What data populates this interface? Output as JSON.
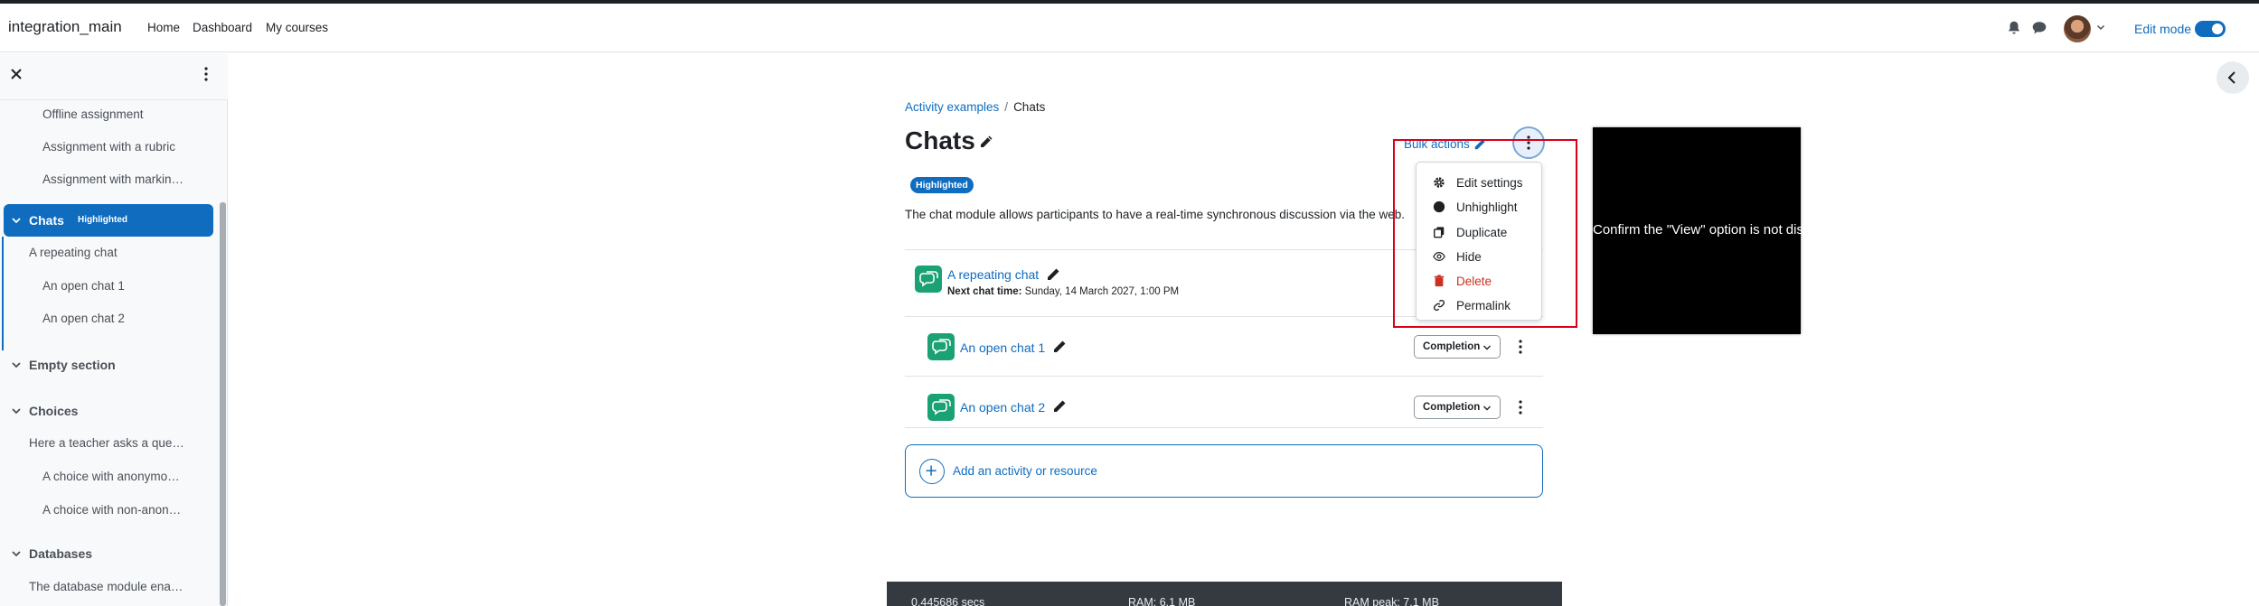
{
  "navbar": {
    "site_name": "integration_main",
    "links": [
      "Home",
      "Dashboard",
      "My courses"
    ],
    "edit_mode_label": "Edit mode",
    "edit_mode_on": true
  },
  "drawer": {
    "items": [
      {
        "label": "Offline assignment",
        "kind": "activity"
      },
      {
        "label": "Assignment with a rubric",
        "kind": "activity"
      },
      {
        "label": "Assignment with markin…",
        "kind": "activity"
      },
      {
        "label": "Chats",
        "kind": "section",
        "badge": "Highlighted",
        "active": true
      },
      {
        "label": "A repeating chat",
        "kind": "activity"
      },
      {
        "label": "An open chat 1",
        "kind": "activity"
      },
      {
        "label": "An open chat 2",
        "kind": "activity"
      },
      {
        "label": "Empty section",
        "kind": "section"
      },
      {
        "label": "Choices",
        "kind": "section"
      },
      {
        "label": "Here a teacher asks a que…",
        "kind": "activity"
      },
      {
        "label": "A choice with anonymo…",
        "kind": "activity"
      },
      {
        "label": "A choice with non-anon…",
        "kind": "activity"
      },
      {
        "label": "Databases",
        "kind": "section"
      },
      {
        "label": "The database module ena…",
        "kind": "activity"
      }
    ]
  },
  "main": {
    "breadcrumb": [
      "Activity examples",
      "/",
      "Chats"
    ],
    "title": "Chats",
    "bulk_actions": "Bulk actions",
    "highlight_badge": "Highlighted",
    "summary": "The chat module allows participants to have a real-time synchronous discussion via the web.",
    "activities": [
      {
        "name": "A repeating chat",
        "next_label": "Next chat time:",
        "next_value": "Sunday, 14 March 2027, 1:00 PM"
      },
      {
        "name": "An open chat 1",
        "completion": "Completion"
      },
      {
        "name": "An open chat 2",
        "completion": "Completion"
      }
    ],
    "add_activity": "Add an activity or resource"
  },
  "menu": {
    "items": [
      {
        "label": "Edit settings",
        "icon": "gear-icon"
      },
      {
        "label": "Unhighlight",
        "icon": "circle-icon"
      },
      {
        "label": "Duplicate",
        "icon": "copy-icon"
      },
      {
        "label": "Hide",
        "icon": "eye-icon"
      },
      {
        "label": "Delete",
        "icon": "trash-icon",
        "danger": true
      },
      {
        "label": "Permalink",
        "icon": "link-icon"
      }
    ]
  },
  "annotation": {
    "text": "Confirm the \"View\" option is not displayed."
  },
  "footer": {
    "items": [
      "0.445686 secs",
      "RAM: 6.1 MB",
      "RAM peak: 7.1 MB"
    ]
  },
  "colors": {
    "brand": "#0f6cbf",
    "activity_icon": "#1aa174",
    "danger": "#ca3120",
    "highlight_frame": "#d9001b"
  }
}
